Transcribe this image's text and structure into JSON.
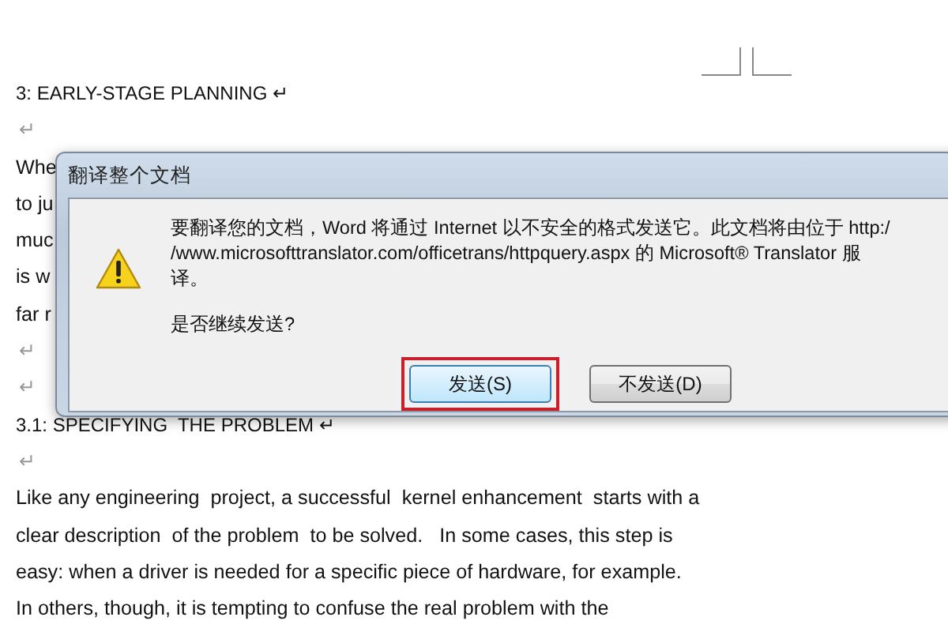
{
  "document": {
    "lines": [
      {
        "kind": "heading",
        "text": "3: EARLY-STAGE PLANNING ↵"
      },
      {
        "kind": "mark",
        "text": "↵"
      },
      {
        "kind": "text",
        "text": "Whe"
      },
      {
        "kind": "text",
        "text": "to ju"
      },
      {
        "kind": "text",
        "text": "muc"
      },
      {
        "kind": "text",
        "text": "is w"
      },
      {
        "kind": "text",
        "text": "far r"
      },
      {
        "kind": "mark",
        "text": "↵"
      },
      {
        "kind": "mark",
        "text": "↵"
      },
      {
        "kind": "heading",
        "text": "3.1: SPECIFYING  THE PROBLEM ↵"
      },
      {
        "kind": "mark",
        "text": "↵"
      },
      {
        "kind": "text",
        "text": "Like any engineering  project, a successful  kernel enhancement  starts with a"
      },
      {
        "kind": "text",
        "text": "clear description  of the problem  to be solved.   In some cases, this step is"
      },
      {
        "kind": "text",
        "text": "easy: when a driver is needed for a specific piece of hardware, for example."
      },
      {
        "kind": "text",
        "text": "In others, though, it is tempting to confuse the real problem with the"
      }
    ]
  },
  "dialog": {
    "title": "翻译整个文档",
    "message": [
      "要翻译您的文档，Word 将通过 Internet 以不安全的格式发送它。此文档将由位于 http:/",
      "/www.microsofttranslator.com/officetrans/httpquery.aspx 的 Microsoft® Translator 服",
      "译。"
    ],
    "question": "是否继续发送?",
    "buttons": [
      {
        "label": "发送(S)",
        "highlighted": true
      },
      {
        "label": "不发送(D)",
        "highlighted": false
      }
    ]
  }
}
